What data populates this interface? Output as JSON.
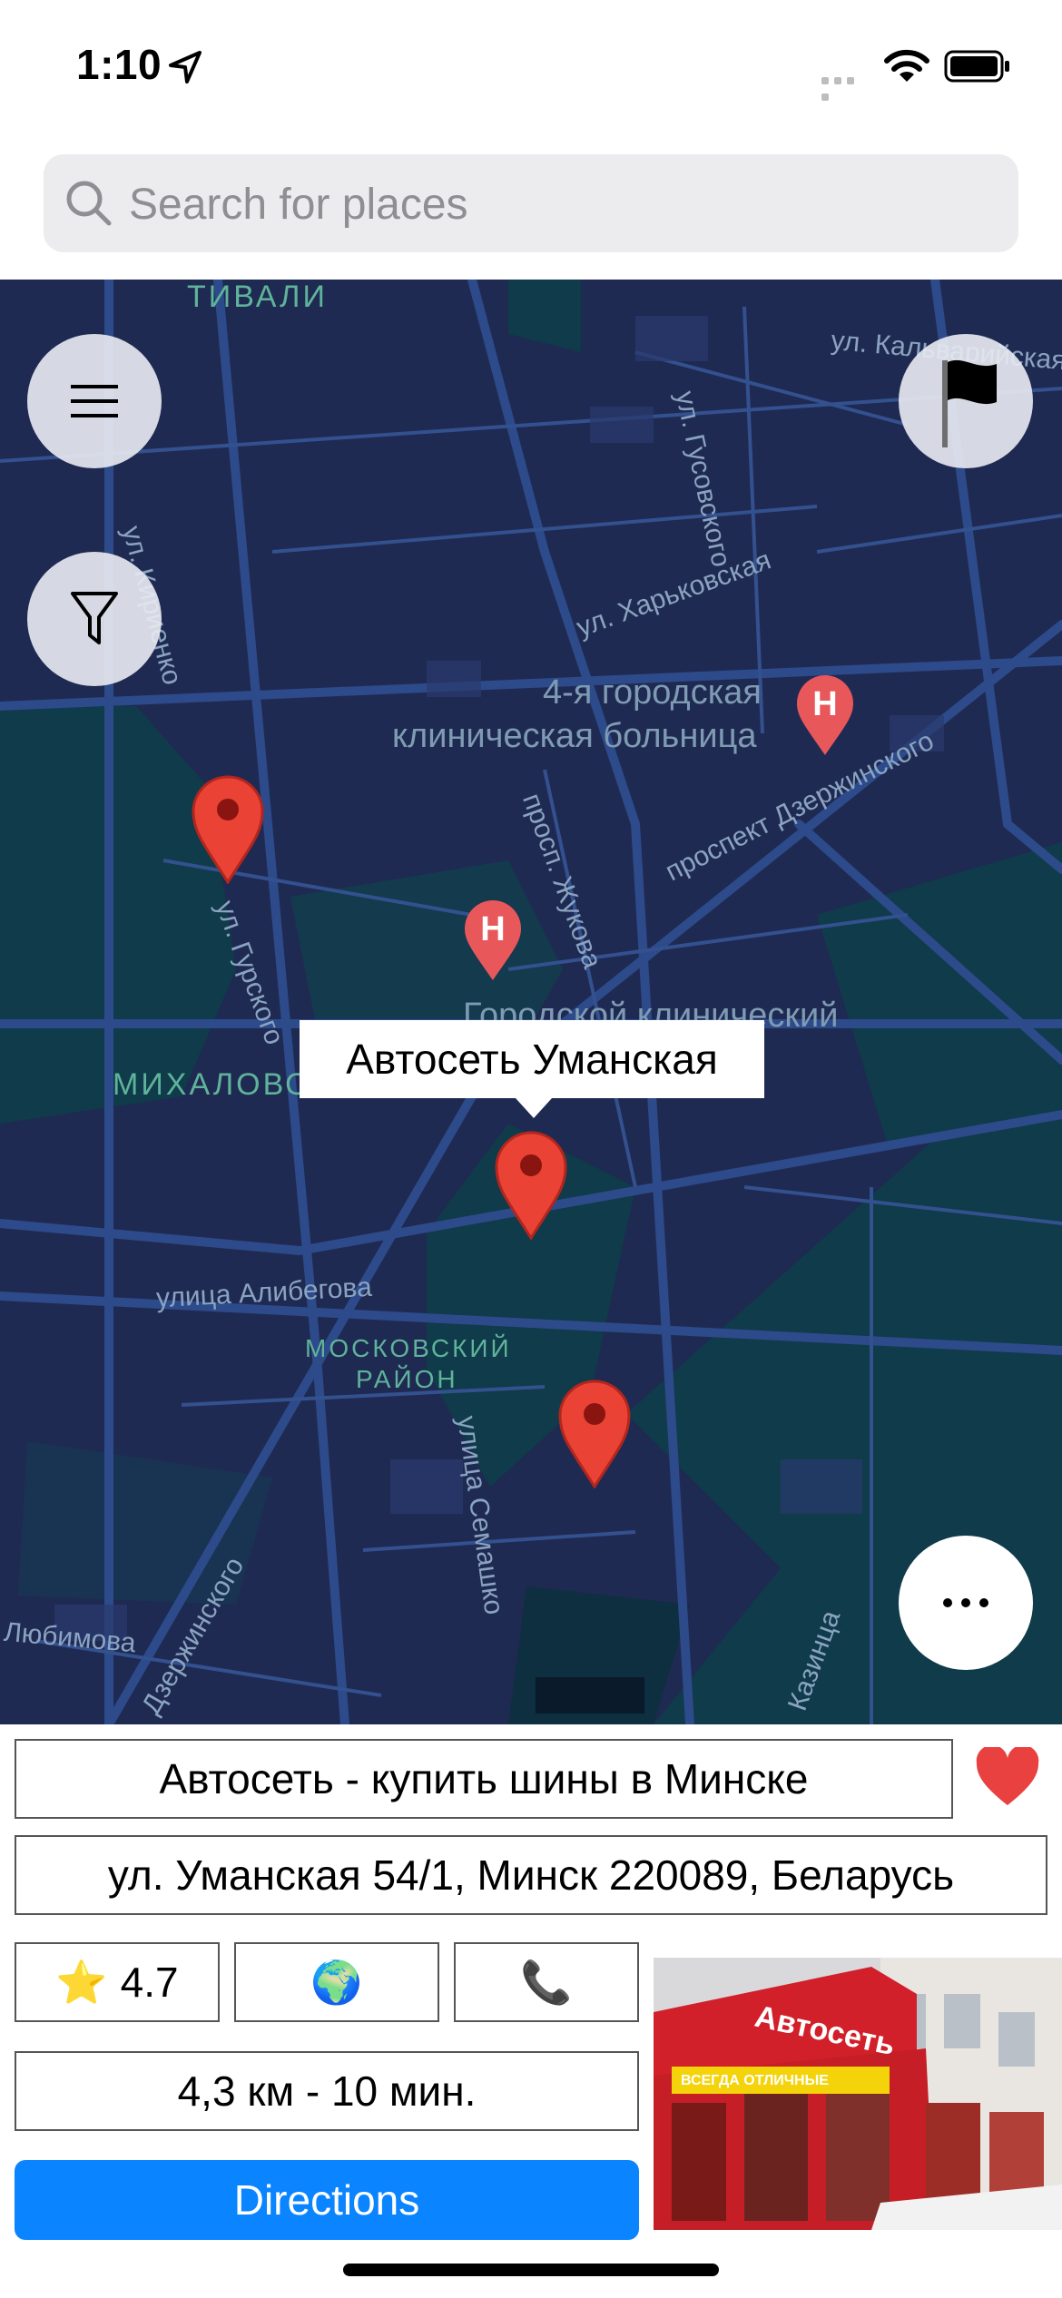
{
  "status_bar": {
    "time": "1:10",
    "icons": [
      "location-arrow-icon",
      "signal-icon",
      "wifi-icon",
      "battery-icon"
    ]
  },
  "search": {
    "placeholder": "Search for places",
    "value": ""
  },
  "map": {
    "labels": {
      "tivali": "ТИВАЛИ",
      "kalvariyskaya": "ул. Кальварийская",
      "gusovskogo": "ул. Гусовского",
      "kirenko": "ул. Кириенко",
      "kharkovskaya": "ул. Харьковская",
      "hospital4_line1": "4-я городская",
      "hospital4_line2": "клиническая больница",
      "zhukova": "просп. Жукова",
      "dzerzhinskogo": "проспект Дзержинского",
      "gurskogo": "ул. Гурского",
      "gorodskoy": "Городской клинический",
      "mikhalovo": "МИХАЛОВО",
      "alibegova": "улица Алибегова",
      "moskovsky_line1": "МОСКОВСКИЙ",
      "moskovsky_line2": "РАЙОН",
      "semashko": "улица Семашко",
      "dzerzhinskogo2": "Дзержинского",
      "lyubimova": "Любимова",
      "kazintsa": "Казинца"
    },
    "tooltip": "Автосеть Уманская",
    "buttons": [
      "menu-icon",
      "filter-icon",
      "flag-icon",
      "more-icon"
    ],
    "colors": {
      "water": "#0f3b4a",
      "roads": "#2d4a8a",
      "background": "#1f2a52",
      "pin": "#ea4335"
    }
  },
  "place": {
    "name": "Автосеть - купить шины в Минске",
    "address": "ул. Уманская 54/1, Минск 220089, Беларусь",
    "rating": "4.7",
    "rating_icon": "⭐",
    "website_icon": "🌍",
    "phone_icon": "📞",
    "distance": "4,3 км - 10 мин.",
    "directions_label": "Directions",
    "favorite": true,
    "photo_signage": [
      "Автосеть",
      "ВСЕГДА ОТЛИЧНЫЕ"
    ],
    "accent": "#0a84ff",
    "heart_color": "#e94040"
  }
}
